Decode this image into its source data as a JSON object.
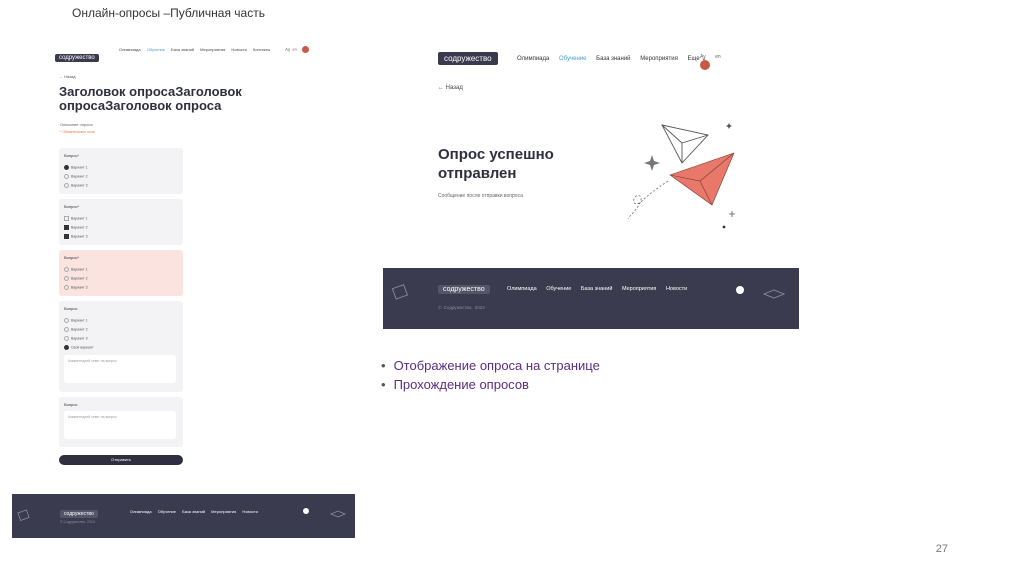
{
  "slide": {
    "title": "Онлайн-опросы –Публичная часть",
    "page_number": "27",
    "bullets": [
      "Отображение опроса на странице",
      "Прохождение опросов"
    ]
  },
  "brand": {
    "logo": "содружество",
    "dark": "#3b3b50",
    "accent": "#4a9bd8",
    "error_bg": "#fbe3df",
    "plane_color": "#e8786a"
  },
  "survey_page": {
    "nav": [
      "Олимпиада",
      "Обучение",
      "База знаний",
      "Мероприятия",
      "Новости",
      "Контакты"
    ],
    "nav_active": "Обучение",
    "nav_right": [
      "Ag",
      "en"
    ],
    "back": "← Назад",
    "title": "Заголовок опросаЗаголовок опросаЗаголовок опроса",
    "description": "Описание опроса",
    "required_note": "* Обязательные поля",
    "questions": [
      {
        "label": "Вопрос*",
        "type": "radio",
        "options": [
          "Вариант 1",
          "Вариант 2",
          "Вариант 3"
        ],
        "selected": [
          0
        ]
      },
      {
        "label": "Вопрос*",
        "type": "checkbox",
        "options": [
          "Вариант 1",
          "Вариант 2",
          "Вариант 3"
        ],
        "selected": [
          1,
          2
        ]
      },
      {
        "label": "Вопрос*",
        "type": "radio",
        "options": [
          "Вариант 1",
          "Вариант 2",
          "Вариант 3"
        ],
        "selected": [],
        "error": true
      },
      {
        "label": "Вопрос",
        "type": "radio",
        "options": [
          "Вариант 1",
          "Вариант 2",
          "Вариант 3",
          "Свой вариант"
        ],
        "selected": [
          3
        ],
        "textarea_placeholder": "Комментарий ответ на вопрос"
      },
      {
        "label": "Вопрос",
        "type": "text",
        "textarea_placeholder": "Комментарий ответ на вопрос"
      }
    ],
    "submit": "Отправить",
    "footer": {
      "links": [
        "Олимпиада",
        "Обучение",
        "База знаний",
        "Мероприятия",
        "Новости"
      ],
      "copyright": "© Содружество, 2024"
    }
  },
  "success_page": {
    "nav": [
      "Олимпиада",
      "Обучение",
      "База знаний",
      "Мероприятия",
      "Еще ⌄"
    ],
    "nav_active": "Обучение",
    "nav_right": [
      "Ay",
      "en"
    ],
    "back": "← Назад",
    "title": "Опрос успешно отправлен",
    "message": "Сообщение после отправки вопроса",
    "footer": {
      "links": [
        "Олимпиада",
        "Обучение",
        "База знаний",
        "Мероприятия",
        "Новости"
      ],
      "copyright": "© Содружество, 2024"
    }
  }
}
